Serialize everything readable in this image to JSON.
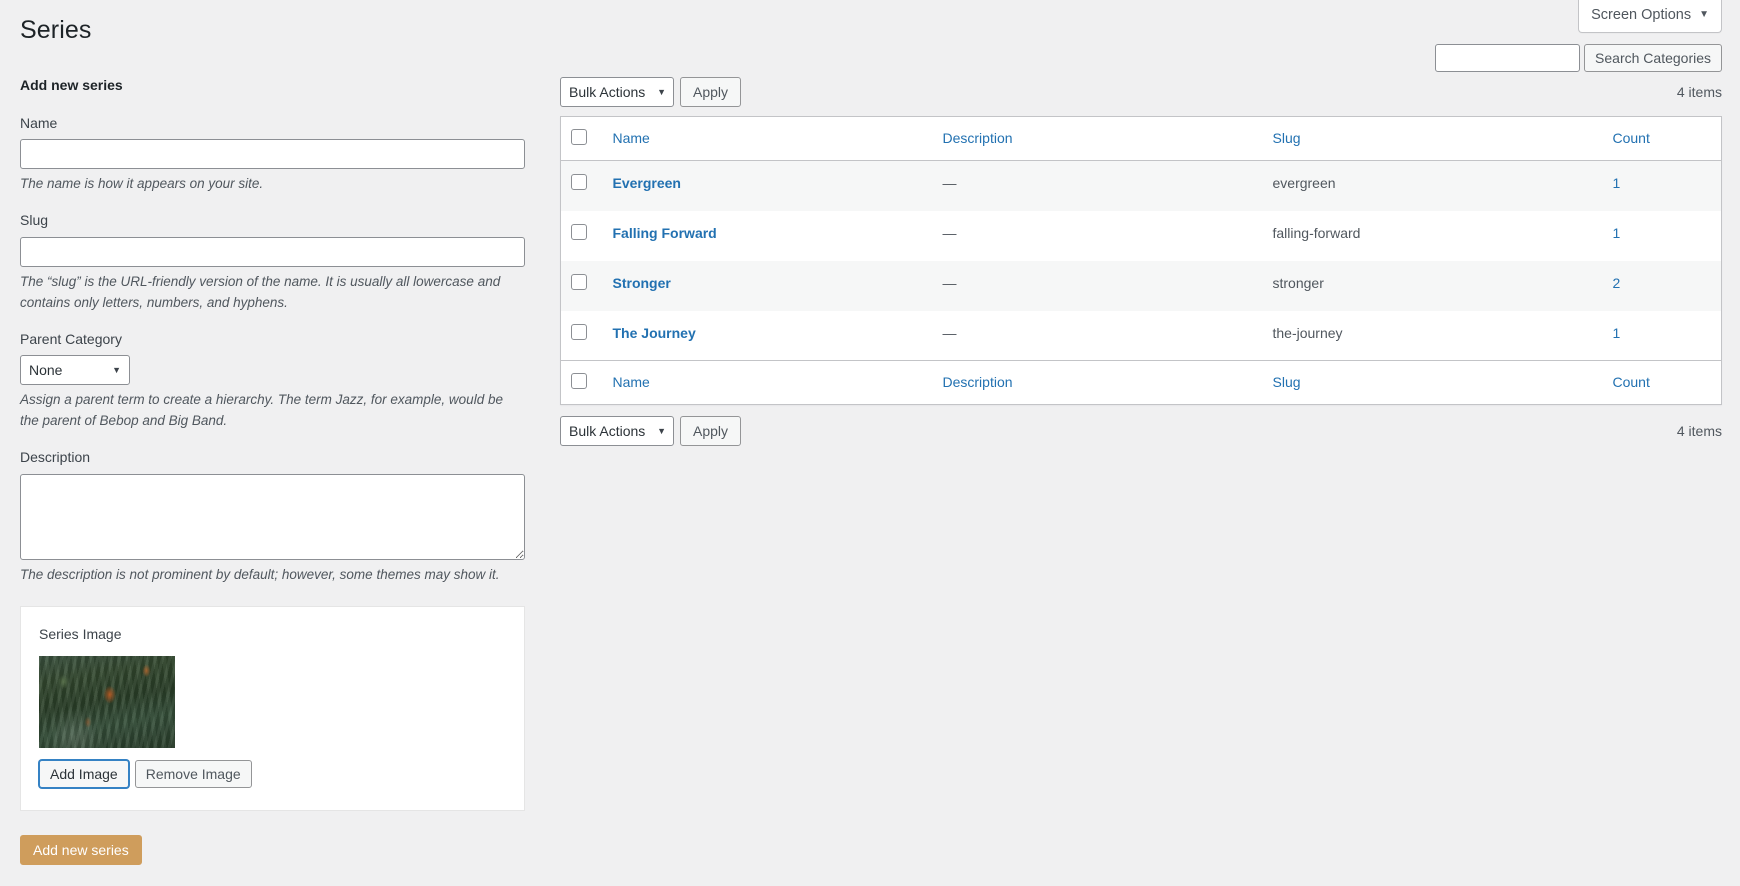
{
  "screen_options": {
    "label": "Screen Options",
    "caret": "▼"
  },
  "page": {
    "title": "Series"
  },
  "search": {
    "value": "",
    "placeholder": "",
    "submit_label": "Search Categories"
  },
  "form": {
    "heading": "Add new series",
    "name": {
      "label": "Name",
      "value": "",
      "placeholder": "",
      "help": "The name is how it appears on your site."
    },
    "slug": {
      "label": "Slug",
      "value": "",
      "placeholder": "",
      "help": "The “slug” is the URL-friendly version of the name. It is usually all lowercase and contains only letters, numbers, and hyphens."
    },
    "parent": {
      "label": "Parent Category",
      "selected": "None",
      "options": [
        "None"
      ],
      "caret": "▼",
      "help": "Assign a parent term to create a hierarchy. The term Jazz, for example, would be the parent of Bebop and Big Band."
    },
    "description": {
      "label": "Description",
      "value": "",
      "placeholder": "",
      "help": "The description is not prominent by default; however, some themes may show it."
    },
    "series_image": {
      "label": "Series Image",
      "add_label": "Add Image",
      "remove_label": "Remove Image",
      "image_alt": "forest-thumbnail"
    },
    "submit_label": "Add new series",
    "submit_color": "#cf9d5c"
  },
  "list": {
    "bulk": {
      "selected": "Bulk Actions",
      "options": [
        "Bulk Actions"
      ],
      "caret": "▼",
      "apply_label": "Apply"
    },
    "items_count_top": "4 items",
    "items_count_bottom": "4 items",
    "columns": {
      "name": "Name",
      "description": "Description",
      "slug": "Slug",
      "count": "Count"
    },
    "rows": [
      {
        "name": "Evergreen",
        "description": "—",
        "slug": "evergreen",
        "count": "1"
      },
      {
        "name": "Falling Forward",
        "description": "—",
        "slug": "falling-forward",
        "count": "1"
      },
      {
        "name": "Stronger",
        "description": "—",
        "slug": "stronger",
        "count": "2"
      },
      {
        "name": "The Journey",
        "description": "—",
        "slug": "the-journey",
        "count": "1"
      }
    ]
  },
  "colors": {
    "link": "#2271b1",
    "page_bg": "#f0f0f1",
    "primary_button": "#cf9d5c",
    "focus_ring": "#3582c4"
  }
}
